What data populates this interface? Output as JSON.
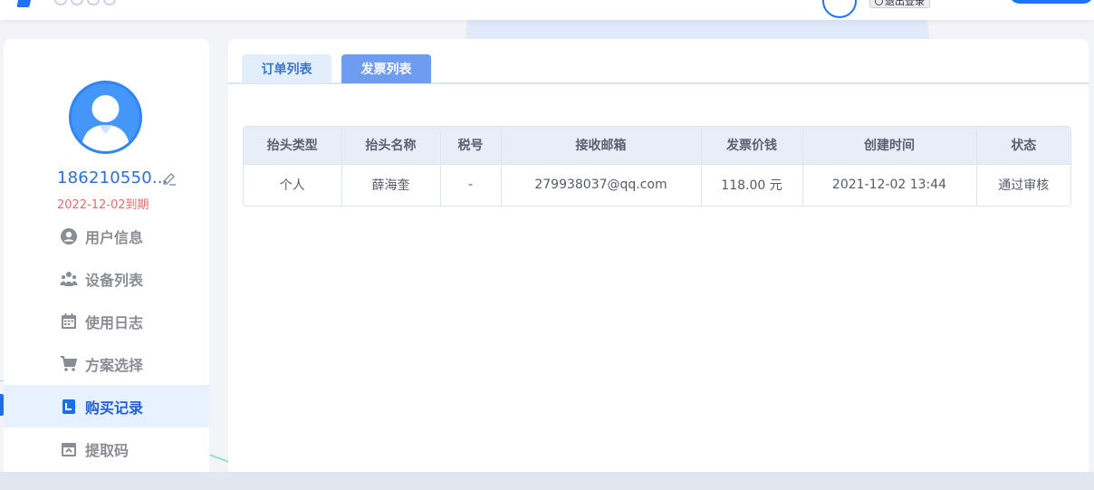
{
  "header": {
    "logout_label": "退出登录"
  },
  "user": {
    "phone": "186210550...",
    "expire": "2022-12-02到期"
  },
  "sidebar": {
    "items": [
      {
        "label": "用户信息",
        "icon": "user-circle-icon"
      },
      {
        "label": "设备列表",
        "icon": "users-icon"
      },
      {
        "label": "使用日志",
        "icon": "calendar-icon"
      },
      {
        "label": "方案选择",
        "icon": "cart-icon"
      },
      {
        "label": "购买记录",
        "icon": "receipt-icon",
        "active": true
      },
      {
        "label": "提取码",
        "icon": "archive-icon"
      }
    ]
  },
  "tabs": [
    {
      "label": "订单列表",
      "active": false
    },
    {
      "label": "发票列表",
      "active": true
    }
  ],
  "invoice_table": {
    "columns": [
      "抬头类型",
      "抬头名称",
      "税号",
      "接收邮箱",
      "发票价钱",
      "创建时间",
      "状态"
    ],
    "rows": [
      [
        "个人",
        "薛海奎",
        "-",
        "279938037@qq.com",
        "118.00 元",
        "2021-12-02 13:44",
        "通过审核"
      ]
    ]
  },
  "colors": {
    "accent": "#1e74f5",
    "active_tab": "#6d9cf0",
    "expire_text": "#e56b6b"
  }
}
